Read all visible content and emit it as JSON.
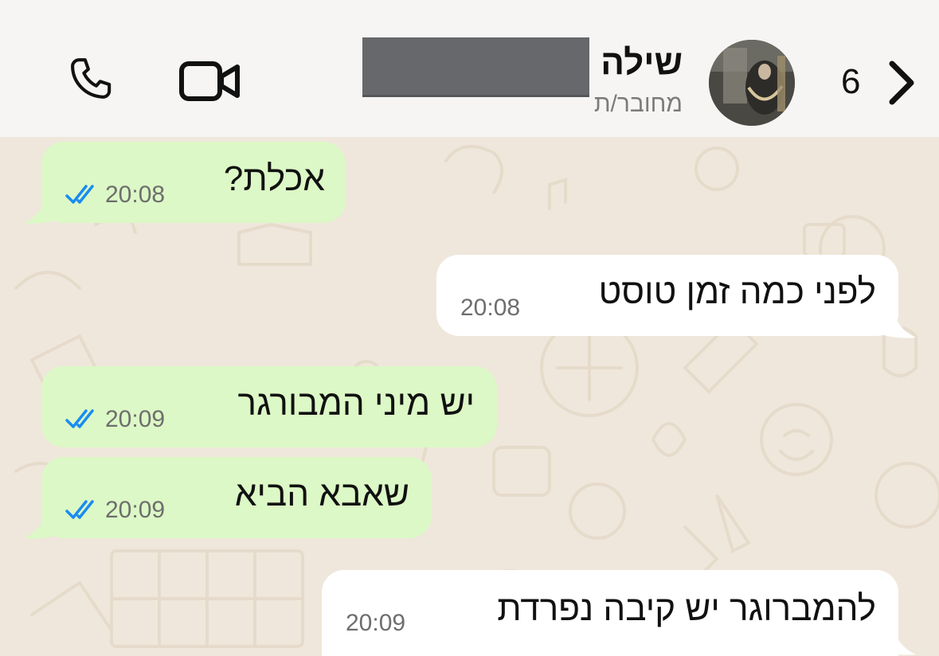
{
  "header": {
    "back_count": "6",
    "contact_name": "שילה",
    "contact_status": "מחובר/ת"
  },
  "messages": [
    {
      "direction": "outgoing",
      "text": "אכלת?",
      "time": "20:08",
      "read": true
    },
    {
      "direction": "incoming",
      "text": "לפני כמה זמן טוסט",
      "time": "20:08"
    },
    {
      "direction": "outgoing",
      "text": "יש מיני המבורגר",
      "time": "20:09",
      "read": true
    },
    {
      "direction": "outgoing",
      "text": "שאבא הביא",
      "time": "20:09",
      "read": true
    },
    {
      "direction": "incoming",
      "text": "להמברוגר יש קיבה נפרדת",
      "time": "20:09"
    }
  ],
  "colors": {
    "outgoing_bubble": "#dcf8c6",
    "incoming_bubble": "#ffffff",
    "read_ticks": "#1a8cf0",
    "chat_background": "#efe7db",
    "header_background": "#f6f5f3"
  },
  "icons": {
    "back": "chevron-left-icon",
    "video": "video-camera-icon",
    "call": "phone-icon"
  }
}
